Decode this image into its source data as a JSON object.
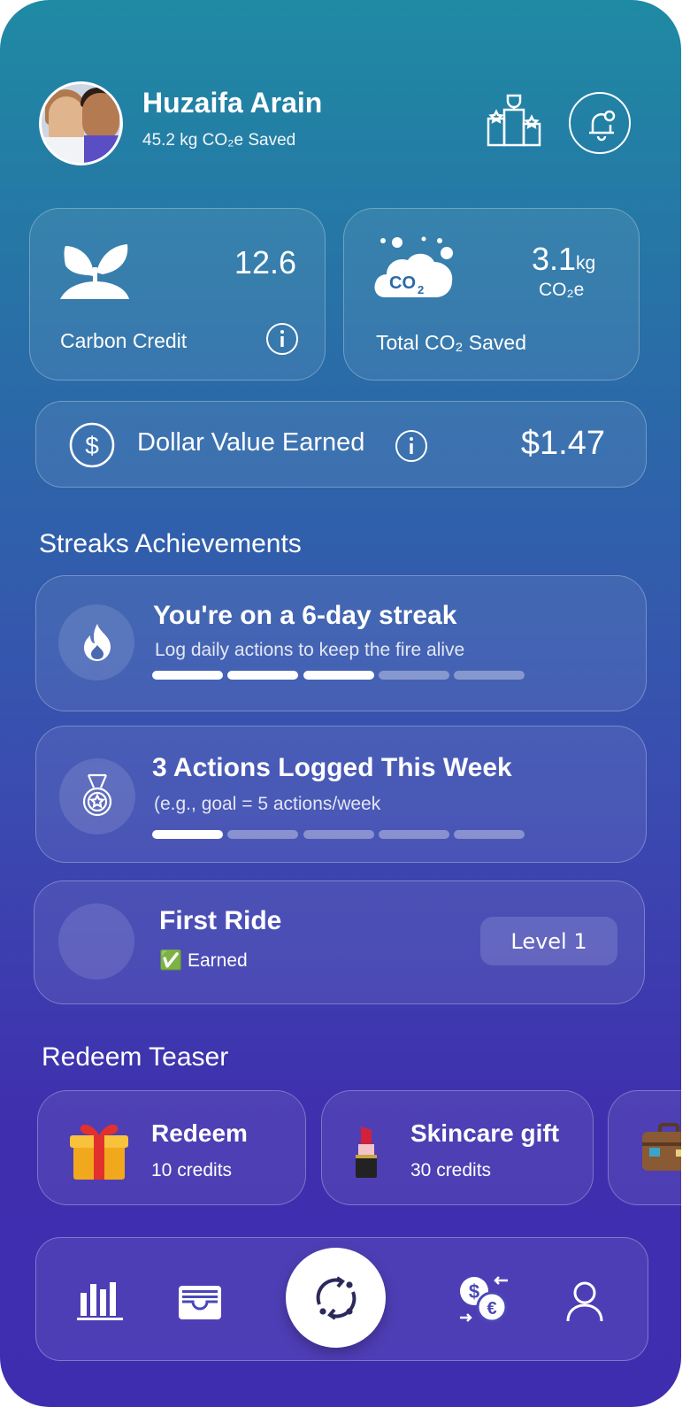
{
  "profile": {
    "name": "Huzaifa Arain",
    "subtitle": "45.2 kg CO₂e Saved"
  },
  "icons": {
    "leaderboard": "podium-trophy-icon",
    "notifications": "bell-icon",
    "carbon_credit": "sprout-icon",
    "co2": "co2-cloud-icon",
    "dollar": "dollar-circle-icon",
    "info": "info-icon",
    "streak": "flame-icon",
    "actions": "medal-icon"
  },
  "stats": {
    "carbon_credit": {
      "value": "12.6",
      "label": "Carbon Credit"
    },
    "co2_saved": {
      "value": "3.1",
      "unit": "kg",
      "unit2": "CO₂e",
      "label": "Total CO₂ Saved"
    },
    "dollar": {
      "label": "Dollar Value Earned",
      "value": "$1.47"
    }
  },
  "streaks": {
    "heading": "Streaks Achievements",
    "items": [
      {
        "title": "You're on a 6-day streak",
        "subtitle": "Log daily actions to keep the fire alive",
        "progress_filled": 3,
        "progress_total": 5
      },
      {
        "title": "3 Actions Logged This Week",
        "subtitle": "(e.g., goal = 5 actions/week",
        "progress_filled": 1,
        "progress_total": 5
      },
      {
        "title": "First Ride",
        "subtitle": "✅ Earned",
        "level": "Level 1"
      }
    ]
  },
  "redeem": {
    "heading": "Redeem Teaser",
    "items": [
      {
        "title": "Redeem",
        "subtitle": "10 credits",
        "icon": "gift-icon"
      },
      {
        "title": "Skincare gift",
        "subtitle": "30 credits",
        "icon": "lipstick-icon"
      },
      {
        "title": "",
        "subtitle": "",
        "icon": "suitcase-icon"
      }
    ]
  },
  "bottom_nav": [
    {
      "name": "stats",
      "icon": "bar-chart-icon"
    },
    {
      "name": "wallet",
      "icon": "wallet-icon"
    },
    {
      "name": "sync",
      "icon": "sync-icon"
    },
    {
      "name": "exchange",
      "icon": "currency-exchange-icon"
    },
    {
      "name": "profile",
      "icon": "user-icon"
    }
  ]
}
